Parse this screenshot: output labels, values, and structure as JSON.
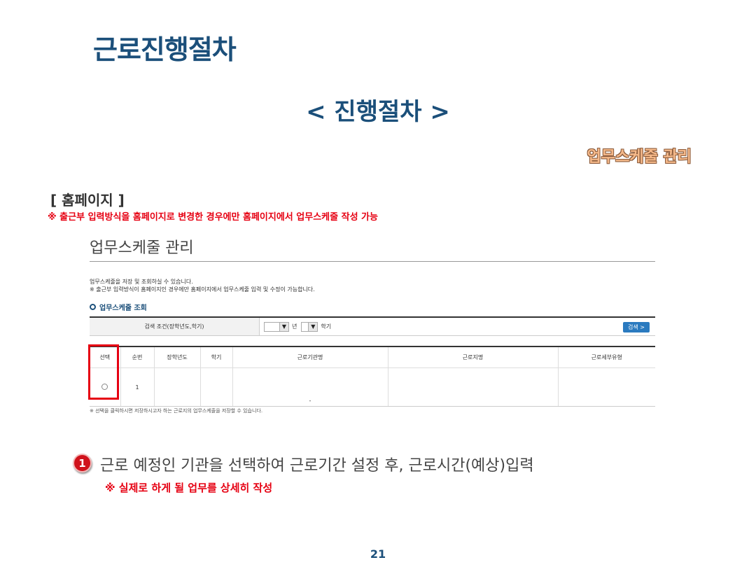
{
  "header": {
    "title": "근로진행절차",
    "subtitle": "< 진행절차 >",
    "badge": "업무스케줄 관리"
  },
  "section": {
    "label": "[ 홈페이지 ]",
    "note": "※ 출근부 입력방식을 홈페이지로 변경한 경우에만 홈페이지에서 업무스케줄 작성 가능"
  },
  "panel": {
    "title": "업무스케줄 관리",
    "desc_lines": [
      "업무스케줄을 저장 및 조회하실 수 있습니다.",
      "※ 출근부 입력방식이 홈페이지인 경우에만 홈페이지에서 업무스케줄 입력 및 수정이 가능합니다."
    ],
    "subheading": "업무스케줄 조회",
    "search": {
      "label": "검색 조건(장학년도,학기)",
      "year_suffix": "년",
      "term_suffix": "학기",
      "button": "검색 >"
    },
    "table": {
      "headers": [
        "선택",
        "순번",
        "장학년도",
        "학기",
        "근로기관명",
        "근로지명",
        "근로세부유형"
      ],
      "rows": [
        {
          "seq": "1",
          "year": "",
          "term": "",
          "org": "",
          "org_sub": "-",
          "place": "",
          "type": ""
        }
      ]
    },
    "footnote": "※ 선택을 클릭하시면 저장하시고자 하는 근로지의 업무스케줄을 저장할 수 있습니다."
  },
  "step": {
    "number": "1",
    "text": "근로 예정인 기관을 선택하여 근로기간 설정 후, 근로시간(예상)입력",
    "note": "※ 실제로 하게 될 업무를 상세히 작성"
  },
  "page_number": "21",
  "colors": {
    "title_blue": "#1b4f7a",
    "highlight_red": "#e60012",
    "button_blue": "#2a7abf"
  }
}
